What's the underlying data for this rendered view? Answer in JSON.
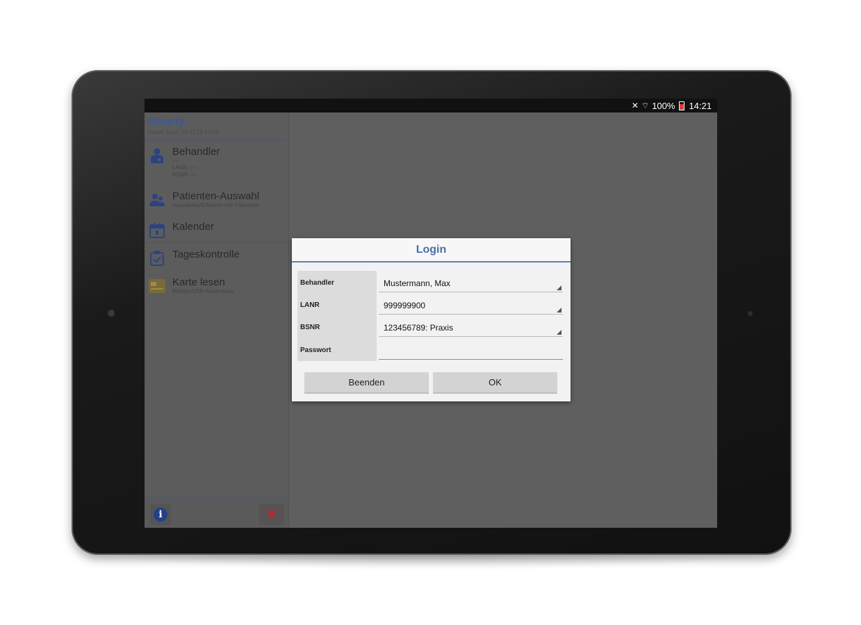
{
  "status_bar": {
    "mute_icon": "mute-icon",
    "wifi_icon": "wifi-icon",
    "battery_percent": "100%",
    "time": "14:21"
  },
  "drawer": {
    "app_title": "Smarty",
    "last_sync": "Letzter Sync: 18.03.16 13:02",
    "items": [
      {
        "label": "Behandler",
        "icon": "doctor-icon",
        "sub": [
          "—",
          "LANR: —",
          "BSNR: —"
        ]
      },
      {
        "label": "Patienten-Auswahl",
        "icon": "patients-icon",
        "sub": [
          "Auswählen/Erfassen von Patienten"
        ]
      },
      {
        "label": "Kalender",
        "icon": "calendar-icon",
        "sub": []
      },
      {
        "label": "Tageskontrolle",
        "icon": "clipboard-icon",
        "sub": []
      },
      {
        "label": "Karte lesen",
        "icon": "chip-card-icon",
        "sub": [
          "Mobiler/USB-Kartenleser"
        ]
      }
    ],
    "footer": {
      "info_icon": "info-icon",
      "close_icon": "close-icon"
    }
  },
  "dialog": {
    "title": "Login",
    "fields": [
      {
        "label": "Behandler",
        "value": "Mustermann, Max"
      },
      {
        "label": "LANR",
        "value": "999999900"
      },
      {
        "label": "BSNR",
        "value": "123456789: Praxis"
      },
      {
        "label": "Passwort",
        "value": ""
      }
    ],
    "buttons": {
      "cancel": "Beenden",
      "ok": "OK"
    }
  },
  "colors": {
    "accent": "#4a6db0",
    "app_title": "#3d5898",
    "close_red": "#c0282a"
  }
}
